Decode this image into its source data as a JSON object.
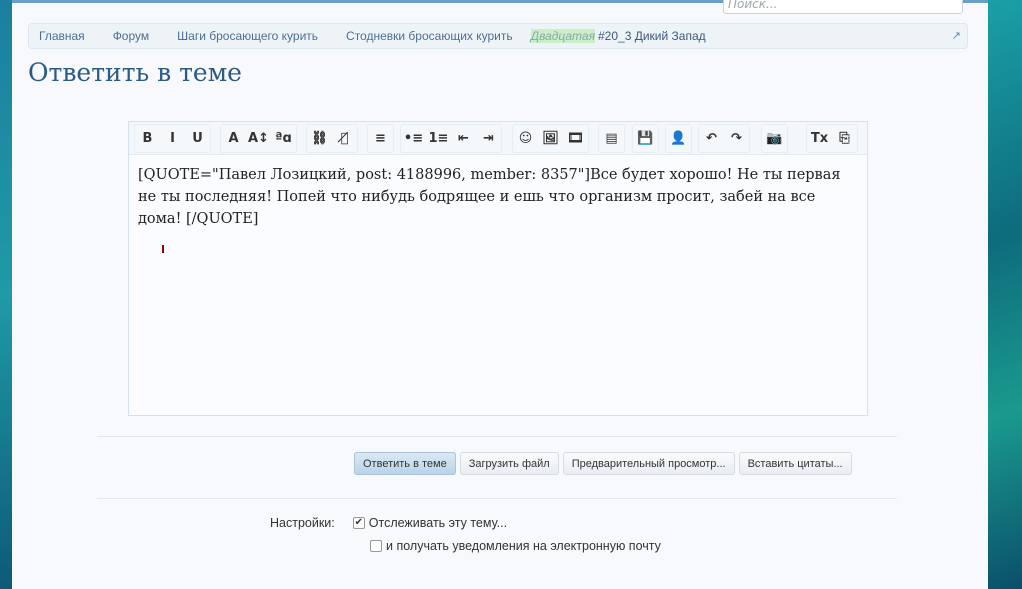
{
  "search": {
    "placeholder": "Поиск..."
  },
  "breadcrumb": {
    "items": [
      "Главная",
      "Форум",
      "Шаги бросающего курить",
      "Стодневки бросающих курить"
    ],
    "prefix": "Двадцатая",
    "current": "#20_3 Дикий Запад"
  },
  "page_title": "Ответить в теме",
  "toolbar": {
    "groups": [
      [
        "B",
        "I",
        "U"
      ],
      [
        "A",
        "A↕",
        "ªɑ"
      ],
      [
        "⛓",
        "⛓̸"
      ],
      [
        "≡"
      ],
      [
        "•≡",
        "1≡",
        "⇤",
        "⇥"
      ],
      [
        "☺",
        "🖼",
        "🎞"
      ],
      [
        "▤"
      ],
      [
        "💾"
      ],
      [
        "👤"
      ],
      [
        "↶",
        "↷"
      ],
      [
        "📷"
      ],
      [
        "Tx",
        "⎘"
      ]
    ]
  },
  "editor": {
    "text": "[QUOTE=\"Павел Лозицкий, post: 4188996, member: 8357\"]Все будет хорошо! Не ты первая не ты последняя! Попей что нибудь бодрящее и ешь что организм просит, забей на все дома! [/QUOTE]"
  },
  "actions": {
    "reply": "Ответить в теме",
    "upload": "Загрузить файл",
    "preview": "Предварительный просмотр...",
    "quotes": "Вставить цитаты..."
  },
  "options": {
    "label": "Настройки:",
    "watch": "Отслеживать эту тему...",
    "watch_checked": true,
    "email": "и получать уведомления на электронную почту",
    "email_checked": false
  }
}
